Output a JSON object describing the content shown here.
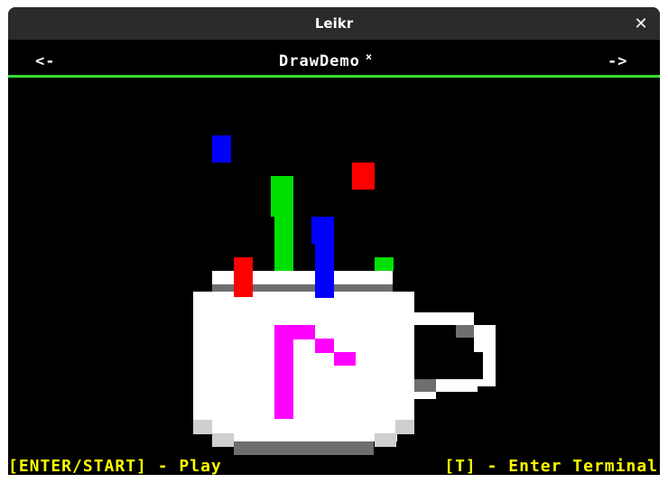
{
  "window": {
    "title": "Leikr",
    "close_glyph": "✕"
  },
  "header": {
    "prev_label": "<-",
    "next_label": "->",
    "cart_title": "DrawDemo",
    "cart_mark": "×"
  },
  "footer": {
    "left_hint": "[ENTER/START] - Play",
    "right_hint": "[T] - Enter Terminal"
  },
  "colors": {
    "accent_green": "#33dd33",
    "hint_yellow": "#ffff00",
    "cup_white": "#ffffff",
    "cup_gray": "#6e6e6e",
    "cup_light_gray": "#cfcfcf",
    "flag_magenta": "#ff00ff",
    "steam_red": "#ff0000",
    "steam_green": "#00e000",
    "steam_blue": "#0000ff"
  }
}
